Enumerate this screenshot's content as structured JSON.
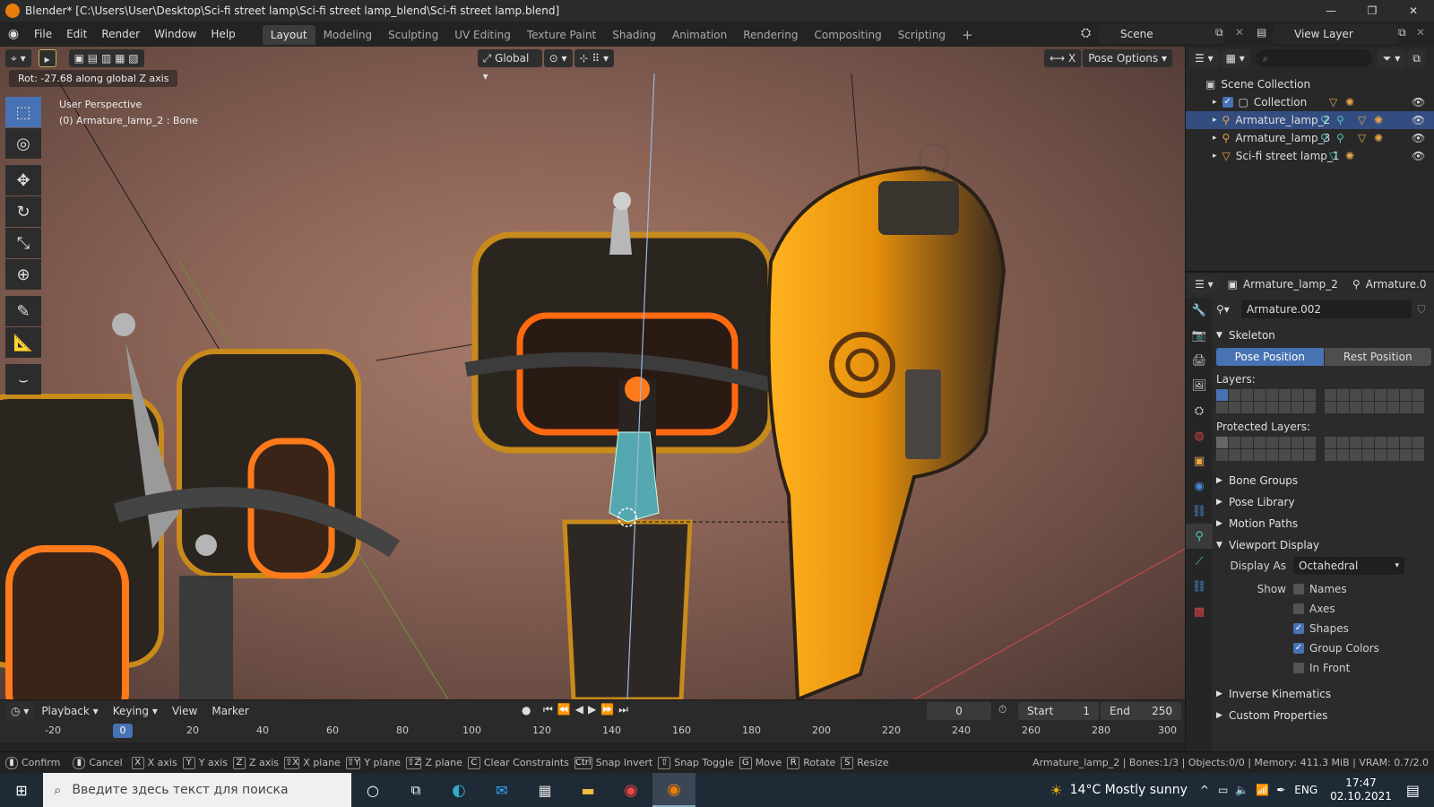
{
  "window": {
    "title": "Blender* [C:\\Users\\User\\Desktop\\Sci-fi street lamp\\Sci-fi street lamp_blend\\Sci-fi street lamp.blend]",
    "minimize": "—",
    "maximize": "❐",
    "close": "✕"
  },
  "menu": {
    "items": [
      "File",
      "Edit",
      "Render",
      "Window",
      "Help"
    ]
  },
  "workspaces": {
    "tabs": [
      "Layout",
      "Modeling",
      "Sculpting",
      "UV Editing",
      "Texture Paint",
      "Shading",
      "Animation",
      "Rendering",
      "Compositing",
      "Scripting"
    ],
    "active": "Layout",
    "add": "+"
  },
  "scene": {
    "label": "Scene"
  },
  "view_layer": {
    "label": "View Layer"
  },
  "viewport": {
    "transform_orientation": "Global",
    "pose_options": "Pose Options",
    "operator_info": "Rot: -27.68 along global Z axis",
    "perspective": "User Perspective",
    "active_object": "(0) Armature_lamp_2 : Bone",
    "x_axis_label": "X"
  },
  "outliner": {
    "search_placeholder": "",
    "rows": [
      {
        "label": "Scene Collection",
        "indent": 0,
        "selected": false
      },
      {
        "label": "Collection",
        "indent": 1,
        "selected": false
      },
      {
        "label": "Armature_lamp_2",
        "indent": 1,
        "selected": true
      },
      {
        "label": "Armature_lamp_3",
        "indent": 1,
        "selected": false
      },
      {
        "label": "Sci-fi street lamp_1",
        "indent": 1,
        "selected": false
      }
    ]
  },
  "properties": {
    "object_name": "Armature_lamp_2",
    "armature_crumb": "Armature.0",
    "data_name": "Armature.002",
    "skeleton": {
      "title": "Skeleton",
      "pose_position": "Pose Position",
      "rest_position": "Rest Position",
      "layers_label": "Layers:",
      "protected_layers_label": "Protected Layers:"
    },
    "panels_collapsed_1": [
      "Bone Groups",
      "Pose Library",
      "Motion Paths"
    ],
    "viewport_display": {
      "title": "Viewport Display",
      "display_as_label": "Display As",
      "display_as_value": "Octahedral",
      "show_label": "Show",
      "options": [
        {
          "label": "Names",
          "checked": false
        },
        {
          "label": "Axes",
          "checked": false
        },
        {
          "label": "Shapes",
          "checked": true
        },
        {
          "label": "Group Colors",
          "checked": true
        },
        {
          "label": "In Front",
          "checked": false
        }
      ]
    },
    "panels_collapsed_2": [
      "Inverse Kinematics",
      "Custom Properties"
    ]
  },
  "timeline": {
    "menus": [
      "Playback",
      "Keying",
      "View",
      "Marker"
    ],
    "current_frame": "0",
    "start_label": "Start",
    "start_value": "1",
    "end_label": "End",
    "end_value": "250",
    "ticks": [
      "-20",
      "0",
      "20",
      "40",
      "60",
      "80",
      "100",
      "120",
      "140",
      "160",
      "180",
      "200",
      "220",
      "240",
      "260",
      "280",
      "300"
    ],
    "current_marker": "0"
  },
  "statusbar": {
    "hints": [
      {
        "key": "",
        "label": "Confirm"
      },
      {
        "key": "",
        "label": "Cancel"
      },
      {
        "key": "X",
        "label": "X axis"
      },
      {
        "key": "Y",
        "label": "Y axis"
      },
      {
        "key": "Z",
        "label": "Z axis"
      },
      {
        "key": "⇧X",
        "label": "X plane"
      },
      {
        "key": "⇧Y",
        "label": "Y plane"
      },
      {
        "key": "⇧Z",
        "label": "Z plane"
      },
      {
        "key": "C",
        "label": "Clear Constraints"
      },
      {
        "key": "Ctrl",
        "label": "Snap Invert"
      },
      {
        "key": "⇧",
        "label": "Snap Toggle"
      },
      {
        "key": "G",
        "label": "Move"
      },
      {
        "key": "R",
        "label": "Rotate"
      },
      {
        "key": "S",
        "label": "Resize"
      }
    ],
    "stats": "Armature_lamp_2 | Bones:1/3 | Objects:0/0 | Memory: 411.3 MiB | VRAM: 0.7/2.0"
  },
  "taskbar": {
    "search_placeholder": "Введите здесь текст для поиска",
    "weather": "14°C  Mostly sunny",
    "language": "ENG",
    "time": "17:47",
    "date": "02.10.2021"
  },
  "colors": {
    "accent": "#4772b3",
    "selection": "#334d80",
    "orange_glow": "#ff7a1a"
  }
}
